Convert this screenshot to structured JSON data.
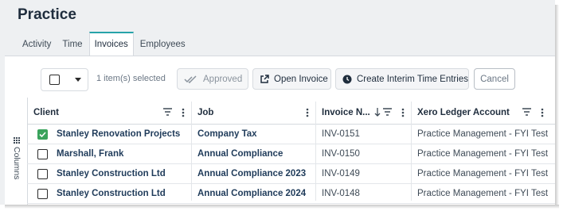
{
  "page": {
    "title": "Practice"
  },
  "tabs": [
    {
      "label": "Activity",
      "active": false
    },
    {
      "label": "Time",
      "active": false
    },
    {
      "label": "Invoices",
      "active": true
    },
    {
      "label": "Employees",
      "active": false
    }
  ],
  "toolbar": {
    "selection_text": "1 item(s) selected",
    "approved_label": "Approved",
    "open_invoice_label": "Open Invoice",
    "interim_label": "Create Interim Time Entries",
    "cancel_label": "Cancel"
  },
  "side": {
    "columns_label": "Columns"
  },
  "table": {
    "headers": {
      "client": "Client",
      "job": "Job",
      "invoice": "Invoice N...",
      "account": "Xero Ledger Account"
    },
    "rows": [
      {
        "checked": true,
        "client": "Stanley Renovation Projects",
        "job": "Company Tax",
        "invoice": "INV-0151",
        "account": "Practice Management - FYI Test"
      },
      {
        "checked": false,
        "client": "Marshall, Frank",
        "job": "Annual Compliance",
        "invoice": "INV-0150",
        "account": "Practice Management - FYI Test"
      },
      {
        "checked": false,
        "client": "Stanley Construction Ltd",
        "job": "Annual Compliance 2023",
        "invoice": "INV-0149",
        "account": "Practice Management - FYI Test"
      },
      {
        "checked": false,
        "client": "Stanley Construction Ltd",
        "job": "Annual Compliance 2024",
        "invoice": "INV-0148",
        "account": "Practice Management - FYI Test"
      }
    ]
  },
  "colors": {
    "accent": "#26a3a9",
    "check": "#3aa35c",
    "link_text": "#1f3b5a"
  },
  "icons": [
    "chevron-down-icon",
    "double-check-icon",
    "open-external-icon",
    "clock-icon",
    "filter-icon",
    "more-vert-icon",
    "sort-down-icon",
    "grid-icon",
    "check-icon"
  ]
}
